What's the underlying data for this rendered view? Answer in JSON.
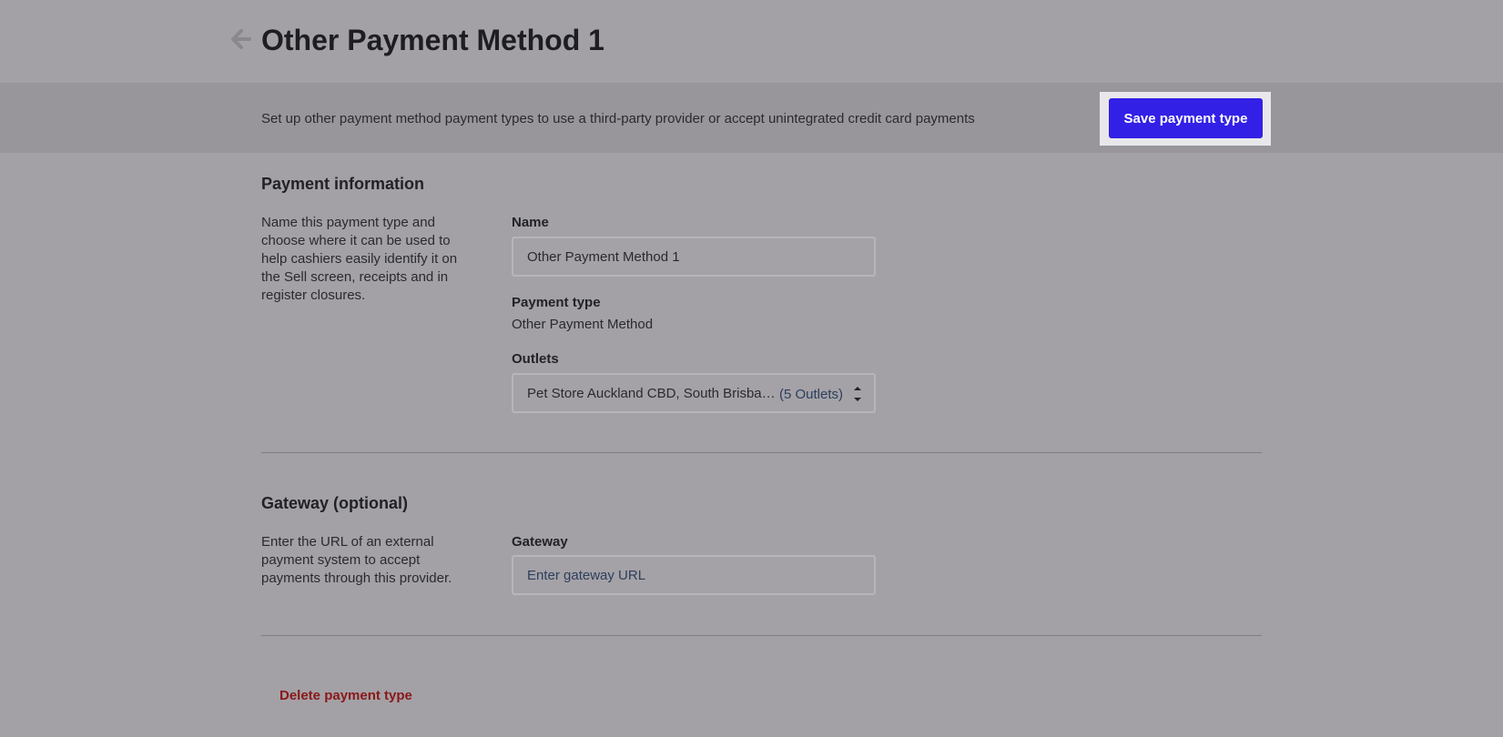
{
  "header": {
    "title": "Other Payment Method 1",
    "back_icon": "arrow-left-icon"
  },
  "banner": {
    "text": "Set up other payment method payment types to use a third-party provider or accept unintegrated credit card payments",
    "save_label": "Save payment type"
  },
  "payment_info": {
    "title": "Payment information",
    "description": "Name this payment type and choose where it can be used to help cashiers easily identify it on the Sell screen, receipts and in register closures.",
    "name_label": "Name",
    "name_value": "Other Payment Method 1",
    "type_label": "Payment type",
    "type_value": "Other Payment Method",
    "outlets_label": "Outlets",
    "outlets_value": "Pet Store Auckland CBD, South Brisbane, Pet Store Wellington, Pet Store Sydney, Pet Store Melbourne",
    "outlets_count": "(5 Outlets)",
    "outlets_icon": "chevron-up-down-icon"
  },
  "gateway": {
    "title": "Gateway (optional)",
    "description": "Enter the URL of an external payment system to accept payments through this provider.",
    "label": "Gateway",
    "value": "",
    "placeholder": "Enter gateway URL"
  },
  "actions": {
    "delete_label": "Delete payment type"
  },
  "colors": {
    "page_background": "#a3a1a6",
    "banner_background": "#98969b",
    "primary_button": "#3320e6",
    "danger_text": "#8a1818"
  }
}
